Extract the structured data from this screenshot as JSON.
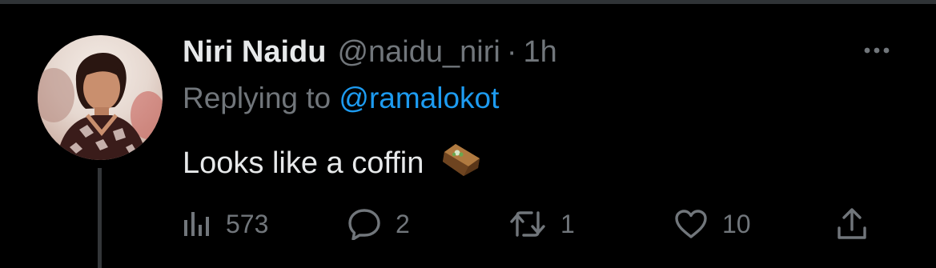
{
  "tweet": {
    "author_name": "Niri Naidu",
    "author_handle": "@naidu_niri",
    "separator": "·",
    "timestamp": "1h",
    "replying_prefix": "Replying to",
    "replying_to": "@ramalokot",
    "text": "Looks like a coffin",
    "emoji": "coffin"
  },
  "actions": {
    "views": "573",
    "replies": "2",
    "retweets": "1",
    "likes": "10"
  },
  "icons": {
    "views": "analytics-icon",
    "reply": "reply-icon",
    "retweet": "retweet-icon",
    "like": "heart-icon",
    "share": "share-icon",
    "more": "more-options-icon"
  },
  "colors": {
    "background": "#000000",
    "primary_text": "#e7e9ea",
    "secondary_text": "#71767b",
    "link": "#1d9bf0",
    "divider": "#2f3336"
  }
}
